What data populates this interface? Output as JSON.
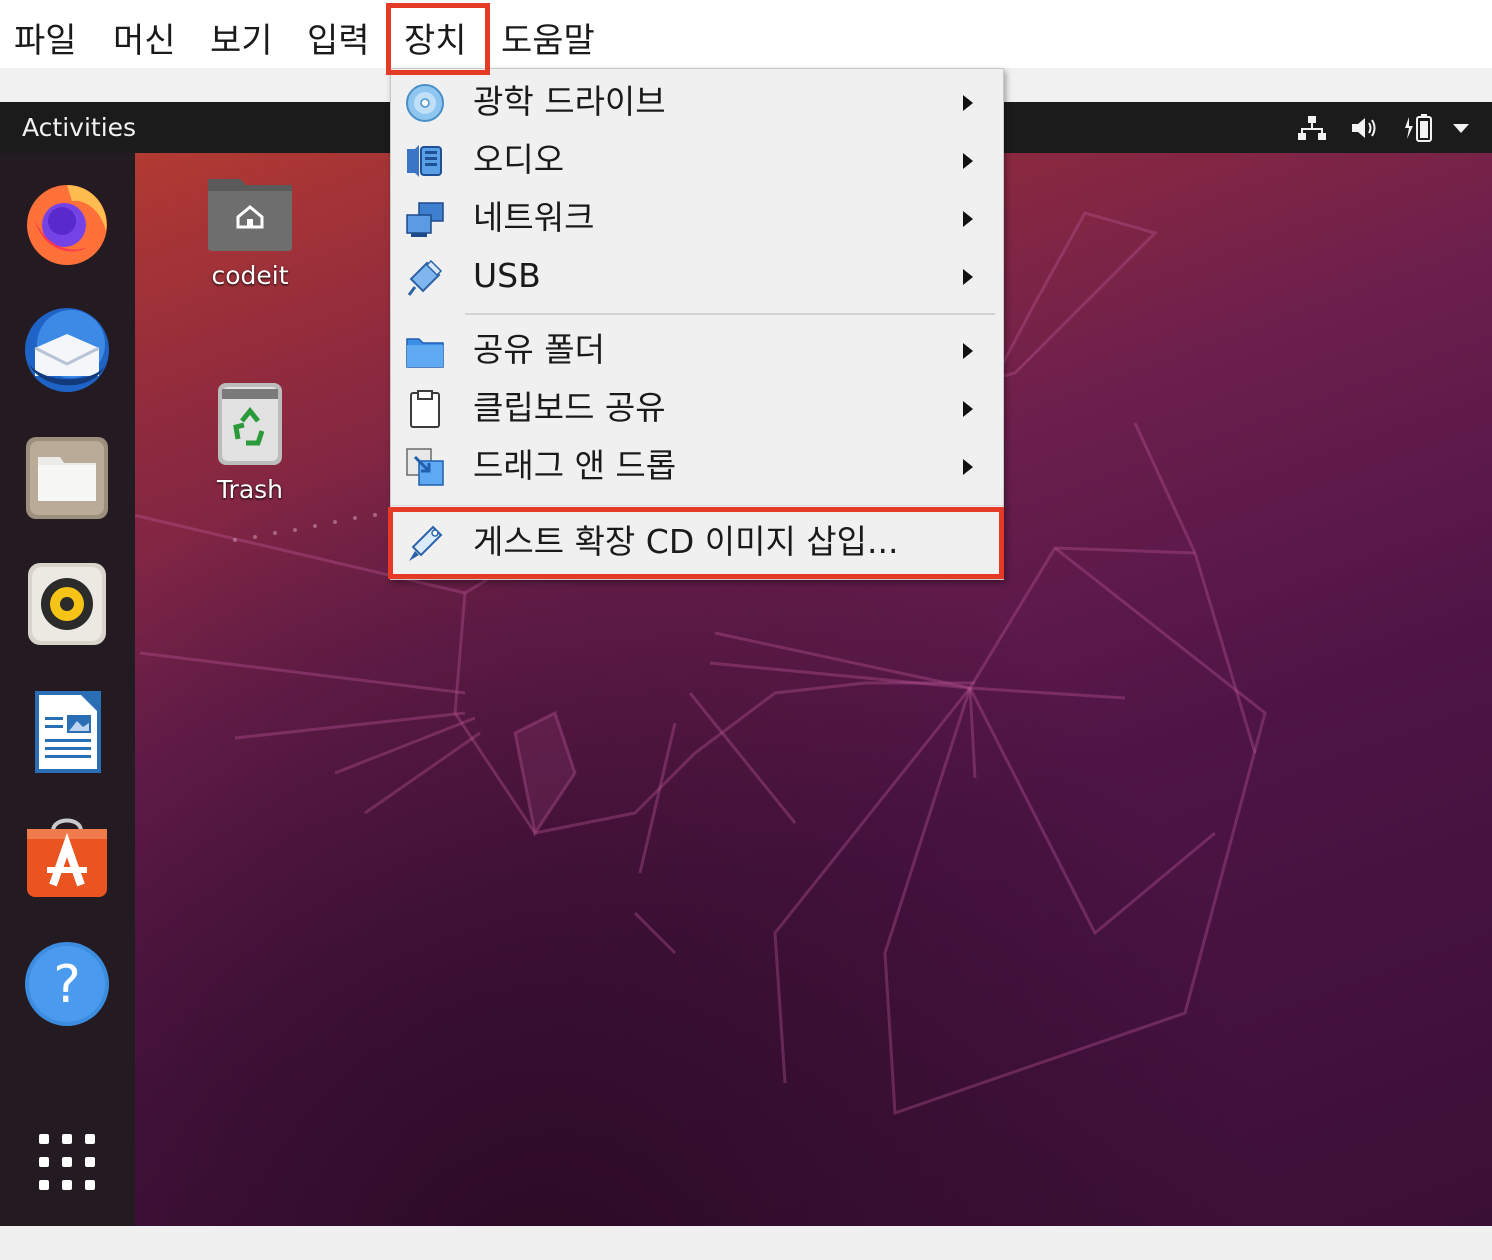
{
  "vbox_menubar": {
    "items": [
      {
        "id": "file",
        "label": "파일"
      },
      {
        "id": "machine",
        "label": "머신"
      },
      {
        "id": "view",
        "label": "보기"
      },
      {
        "id": "input",
        "label": "입력"
      },
      {
        "id": "devices",
        "label": "장치"
      },
      {
        "id": "help",
        "label": "도움말"
      }
    ],
    "highlight_color": "#e43a26"
  },
  "topbar": {
    "activities": "Activities",
    "tray_icons": [
      "network-icon",
      "volume-icon",
      "battery-icon",
      "system-menu-arrow-icon"
    ]
  },
  "dock": {
    "items": [
      {
        "name": "firefox-icon"
      },
      {
        "name": "thunderbird-icon"
      },
      {
        "name": "files-icon"
      },
      {
        "name": "rhythmbox-icon"
      },
      {
        "name": "libreoffice-writer-icon"
      },
      {
        "name": "ubuntu-software-icon"
      },
      {
        "name": "help-icon"
      },
      {
        "name": "show-applications-icon"
      }
    ]
  },
  "desktop": {
    "icons": [
      {
        "name": "home-folder",
        "label": "codeit"
      },
      {
        "name": "trash",
        "label": "Trash"
      }
    ]
  },
  "devices_menu": {
    "items": [
      {
        "icon": "optical-drive-icon",
        "label": "광학 드라이브",
        "submenu": true
      },
      {
        "icon": "audio-icon",
        "label": "오디오",
        "submenu": true
      },
      {
        "icon": "network-adapter-icon",
        "label": "네트워크",
        "submenu": true
      },
      {
        "icon": "usb-icon",
        "label": "USB",
        "submenu": true
      },
      {
        "icon": "shared-folder-icon",
        "label": "공유 폴더",
        "submenu": true
      },
      {
        "icon": "clipboard-icon",
        "label": "클립보드 공유",
        "submenu": true
      },
      {
        "icon": "drag-drop-icon",
        "label": "드래그 앤 드롭",
        "submenu": true
      },
      {
        "icon": "guest-additions-cd-icon",
        "label": "게스트 확장 CD 이미지 삽입...",
        "submenu": false
      }
    ]
  },
  "colors": {
    "ubuntu_purple": "#4e1446",
    "ubuntu_orange": "#e95420",
    "topbar": "#1b1b1b",
    "dock": "#241b22"
  }
}
